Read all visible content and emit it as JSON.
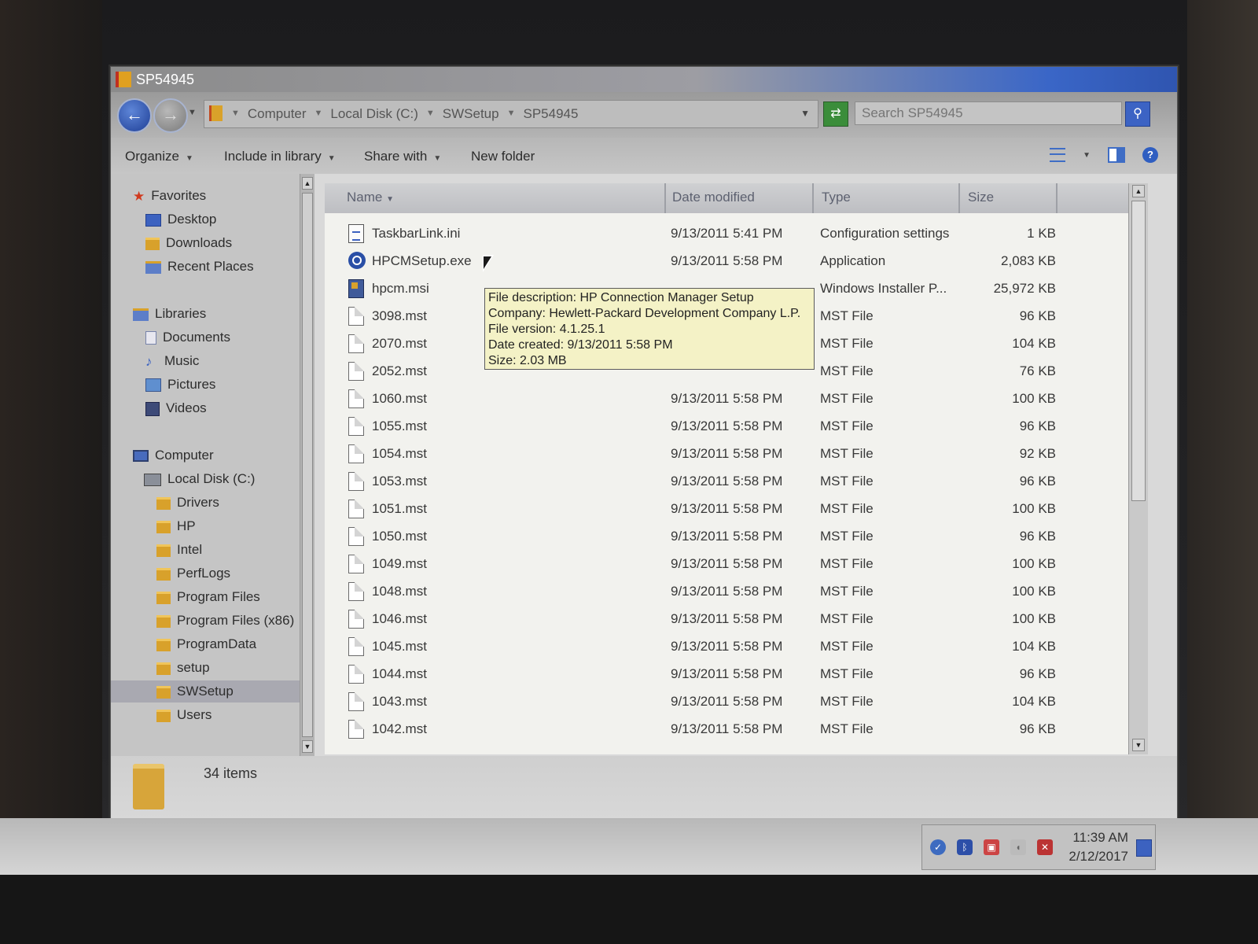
{
  "window": {
    "title": "SP54945",
    "controls": [
      "_",
      "□",
      "×"
    ]
  },
  "address": {
    "crumbs": [
      "Computer",
      "Local Disk (C:)",
      "SWSetup",
      "SP54945"
    ]
  },
  "search": {
    "placeholder": "Search SP54945"
  },
  "toolbar": {
    "organize": "Organize",
    "include": "Include in library",
    "share": "Share with",
    "new_folder": "New folder"
  },
  "nav": {
    "favorites": "Favorites",
    "desktop": "Desktop",
    "downloads": "Downloads",
    "recent": "Recent Places",
    "libraries": "Libraries",
    "documents": "Documents",
    "music": "Music",
    "pictures": "Pictures",
    "videos": "Videos",
    "computer": "Computer",
    "local_disk": "Local Disk (C:)",
    "folders": [
      "Drivers",
      "HP",
      "Intel",
      "PerfLogs",
      "Program Files",
      "Program Files (x86)",
      "ProgramData",
      "setup",
      "SWSetup",
      "Users"
    ]
  },
  "columns": {
    "name": "Name",
    "date": "Date modified",
    "type": "Type",
    "size": "Size"
  },
  "files": [
    {
      "name": "TaskbarLink.ini",
      "date": "9/13/2011 5:41 PM",
      "type": "Configuration settings",
      "size": "1 KB",
      "icon": "ini-file-icon"
    },
    {
      "name": "HPCMSetup.exe",
      "date": "9/13/2011 5:58 PM",
      "type": "Application",
      "size": "2,083 KB",
      "icon": "exe-file-icon"
    },
    {
      "name": "hpcm.msi",
      "date": "",
      "type": "Windows Installer P...",
      "size": "25,972 KB",
      "icon": "msi-file-icon"
    },
    {
      "name": "3098.mst",
      "date": "",
      "type": "MST File",
      "size": "96 KB",
      "icon": "mst-file-icon"
    },
    {
      "name": "2070.mst",
      "date": "",
      "type": "MST File",
      "size": "104 KB",
      "icon": "mst-file-icon"
    },
    {
      "name": "2052.mst",
      "date": "",
      "type": "MST File",
      "size": "76 KB",
      "icon": "mst-file-icon"
    },
    {
      "name": "1060.mst",
      "date": "9/13/2011 5:58 PM",
      "type": "MST File",
      "size": "100 KB",
      "icon": "mst-file-icon"
    },
    {
      "name": "1055.mst",
      "date": "9/13/2011 5:58 PM",
      "type": "MST File",
      "size": "96 KB",
      "icon": "mst-file-icon"
    },
    {
      "name": "1054.mst",
      "date": "9/13/2011 5:58 PM",
      "type": "MST File",
      "size": "92 KB",
      "icon": "mst-file-icon"
    },
    {
      "name": "1053.mst",
      "date": "9/13/2011 5:58 PM",
      "type": "MST File",
      "size": "96 KB",
      "icon": "mst-file-icon"
    },
    {
      "name": "1051.mst",
      "date": "9/13/2011 5:58 PM",
      "type": "MST File",
      "size": "100 KB",
      "icon": "mst-file-icon"
    },
    {
      "name": "1050.mst",
      "date": "9/13/2011 5:58 PM",
      "type": "MST File",
      "size": "96 KB",
      "icon": "mst-file-icon"
    },
    {
      "name": "1049.mst",
      "date": "9/13/2011 5:58 PM",
      "type": "MST File",
      "size": "100 KB",
      "icon": "mst-file-icon"
    },
    {
      "name": "1048.mst",
      "date": "9/13/2011 5:58 PM",
      "type": "MST File",
      "size": "100 KB",
      "icon": "mst-file-icon"
    },
    {
      "name": "1046.mst",
      "date": "9/13/2011 5:58 PM",
      "type": "MST File",
      "size": "100 KB",
      "icon": "mst-file-icon"
    },
    {
      "name": "1045.mst",
      "date": "9/13/2011 5:58 PM",
      "type": "MST File",
      "size": "104 KB",
      "icon": "mst-file-icon"
    },
    {
      "name": "1044.mst",
      "date": "9/13/2011 5:58 PM",
      "type": "MST File",
      "size": "96 KB",
      "icon": "mst-file-icon"
    },
    {
      "name": "1043.mst",
      "date": "9/13/2011 5:58 PM",
      "type": "MST File",
      "size": "104 KB",
      "icon": "mst-file-icon"
    },
    {
      "name": "1042.mst",
      "date": "9/13/2011 5:58 PM",
      "type": "MST File",
      "size": "96 KB",
      "icon": "mst-file-icon"
    }
  ],
  "tooltip": {
    "description": "File description: HP Connection Manager Setup",
    "company": "Company: Hewlett-Packard Development Company L.P.",
    "version": "File version: 4.1.25.1",
    "created": "Date created: 9/13/2011 5:58 PM",
    "size": "Size: 2.03 MB"
  },
  "status": {
    "count": "34 items"
  },
  "taskbar": {
    "time": "11:39 AM",
    "date": "2/12/2017"
  }
}
